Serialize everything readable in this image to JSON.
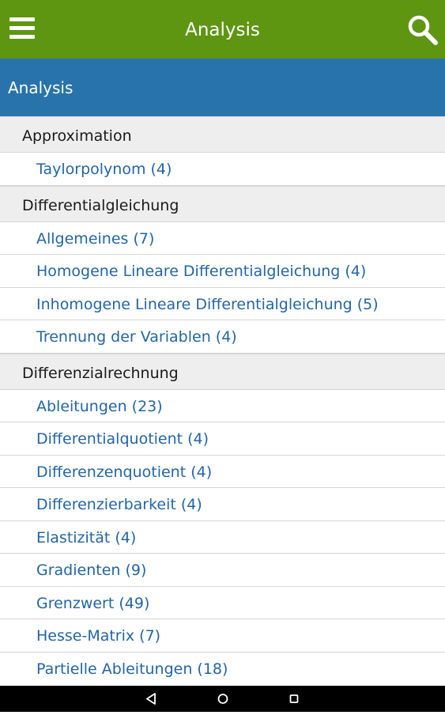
{
  "appbar": {
    "title": "Analysis",
    "menu_icon": "hamburger-menu-icon",
    "search_icon": "search-icon",
    "color": "#5e9612"
  },
  "subbar": {
    "title": "Analysis",
    "color": "#2873ab"
  },
  "sections": [
    {
      "title": "Approximation",
      "items": [
        "Taylorpolynom (4)"
      ]
    },
    {
      "title": "Differentialgleichung",
      "items": [
        "Allgemeines (7)",
        "Homogene Lineare Differentialgleichung (4)",
        "Inhomogene Lineare Differentialgleichung (5)",
        "Trennung der Variablen (4)"
      ]
    },
    {
      "title": "Differenzialrechnung",
      "items": [
        "Ableitungen (23)",
        "Differentialquotient (4)",
        "Differenzenquotient (4)",
        "Differenzierbarkeit (4)",
        "Elastizität (4)",
        "Gradienten (9)",
        "Grenzwert (49)",
        "Hesse-Matrix (7)",
        "Partielle Ableitungen (18)"
      ]
    }
  ],
  "navbar": {
    "back_icon": "back-triangle-icon",
    "home_icon": "home-circle-icon",
    "recents_icon": "recents-square-icon"
  }
}
